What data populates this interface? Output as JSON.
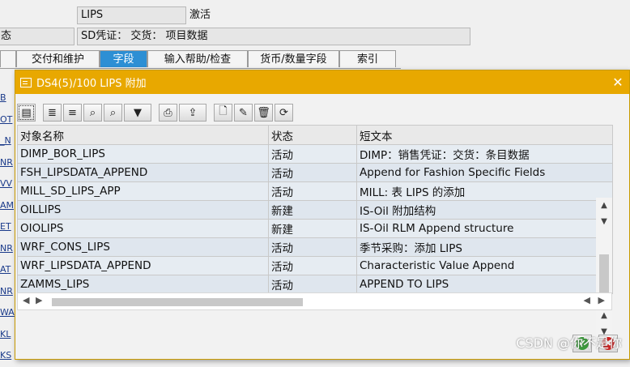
{
  "background": {
    "table_name": "LIPS",
    "status": "激活",
    "left_label_fragment": "态",
    "short_desc": "SD凭证： 交货： 项目数据",
    "tabs": [
      {
        "label": ""
      },
      {
        "label": "交付和维护"
      },
      {
        "label": "字段",
        "active": true
      },
      {
        "label": "输入帮助/检查"
      },
      {
        "label": "货币/数量字段"
      },
      {
        "label": "索引"
      }
    ],
    "left_strip": [
      "B",
      "OT",
      "_N",
      "NR",
      "VV",
      "AM",
      "ET",
      "NR",
      "AT",
      "NR",
      "WA",
      "KL",
      "KS"
    ]
  },
  "dialog": {
    "title": "DS4(5)/100 LIPS 附加",
    "close_glyph": "✕",
    "toolbar": [
      {
        "name": "details-icon",
        "glyph": "▤"
      },
      {
        "name": "sort-ascending-icon",
        "glyph": "≣"
      },
      {
        "name": "sort-descending-icon",
        "glyph": "≡"
      },
      {
        "name": "find-icon",
        "glyph": "⌕"
      },
      {
        "name": "find-next-icon",
        "glyph": "⌕"
      },
      {
        "name": "filter-icon",
        "glyph": "▼"
      },
      {
        "name": "print-icon",
        "glyph": "⎙"
      },
      {
        "name": "export-icon",
        "glyph": "⇪"
      },
      {
        "name": "create-icon",
        "glyph": "🗋"
      },
      {
        "name": "edit-icon",
        "glyph": "✎"
      },
      {
        "name": "delete-icon",
        "glyph": "🗑"
      },
      {
        "name": "refresh-icon",
        "glyph": "⟳"
      }
    ],
    "columns": [
      "对象名称",
      "状态",
      "短文本"
    ],
    "rows": [
      [
        "DIMP_BOR_LIPS",
        "活动",
        "DIMP：销售凭证：交货：条目数据"
      ],
      [
        "FSH_LIPSDATA_APPEND",
        "活动",
        "Append for Fashion Specific Fields"
      ],
      [
        "MILL_SD_LIPS_APP",
        "活动",
        "MILL: 表 LIPS 的添加"
      ],
      [
        "OILLIPS",
        "新建",
        "IS-Oil 附加结构"
      ],
      [
        "OIOLIPS",
        "新建",
        "IS-Oil RLM Append structure"
      ],
      [
        "WRF_CONS_LIPS",
        "活动",
        "季节采购：添加 LIPS"
      ],
      [
        "WRF_LIPSDATA_APPEND",
        "活动",
        "Characteristic Value Append"
      ],
      [
        "ZAMMS_LIPS",
        "活动",
        "APPEND TO LIPS"
      ]
    ],
    "ok_glyph": "✔",
    "cancel_glyph": "✖"
  },
  "watermark": "CSDN @你不是你"
}
